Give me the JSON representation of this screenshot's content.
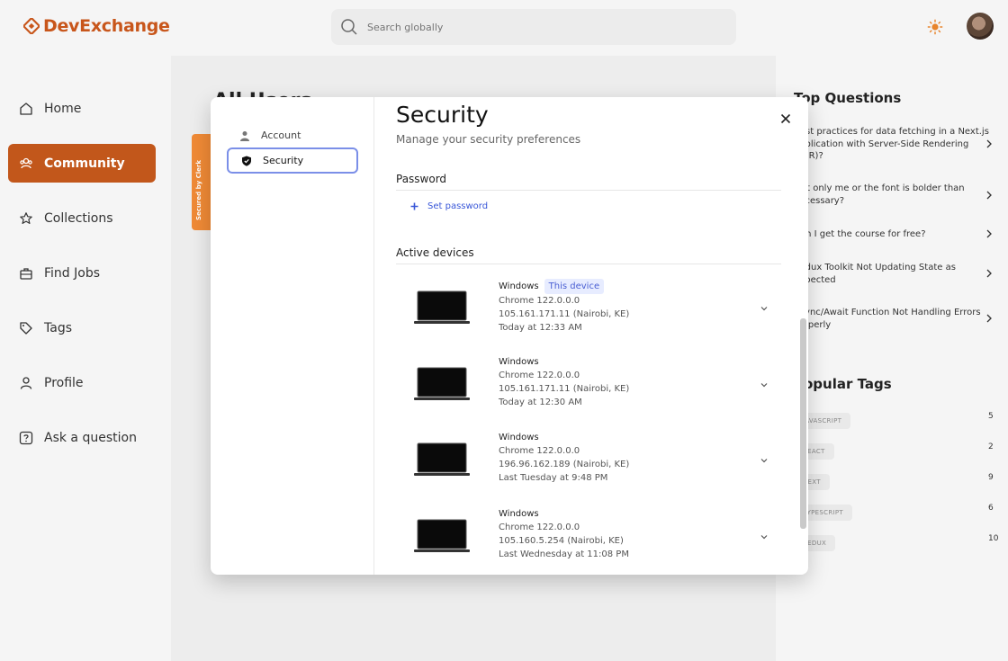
{
  "app": {
    "brand_prefix": "Dev",
    "brand_suffix": "Exchange",
    "search_placeholder": "Search globally"
  },
  "sidebar": {
    "items": [
      {
        "label": "Home",
        "icon": "home-icon"
      },
      {
        "label": "Community",
        "icon": "users-icon",
        "active": true
      },
      {
        "label": "Collections",
        "icon": "star-icon"
      },
      {
        "label": "Find Jobs",
        "icon": "briefcase-icon"
      },
      {
        "label": "Tags",
        "icon": "tag-icon"
      },
      {
        "label": "Profile",
        "icon": "user-icon"
      },
      {
        "label": "Ask a question",
        "icon": "question-icon"
      }
    ]
  },
  "main": {
    "title": "All Users"
  },
  "rightbar": {
    "top_questions_heading": "Top Questions",
    "questions": [
      "Best practices for data fetching in a Next.js application with Server-Side Rendering (SSR)?",
      "Is it only me or the font is bolder than necessary?",
      "Can I get the course for free?",
      "Redux Toolkit Not Updating State as Expected",
      "Async/Await Function Not Handling Errors Properly"
    ],
    "popular_tags_heading": "Popular Tags",
    "tags": [
      {
        "name": "JAVASCRIPT",
        "count": "5"
      },
      {
        "name": "REACT",
        "count": "2"
      },
      {
        "name": "NEXT",
        "count": "9"
      },
      {
        "name": "TYPESCRIPT",
        "count": "6"
      },
      {
        "name": "REDUX",
        "count": "10"
      }
    ]
  },
  "clerk_badge": "Secured by Clerk",
  "modal": {
    "nav": [
      {
        "label": "Account",
        "icon": "user-icon"
      },
      {
        "label": "Security",
        "icon": "shield-icon",
        "active": true
      }
    ],
    "title": "Security",
    "subtitle": "Manage your security preferences",
    "password_heading": "Password",
    "set_password_label": "Set password",
    "devices_heading": "Active devices",
    "this_device_badge": "This device",
    "devices": [
      {
        "os": "Windows",
        "browser": "Chrome 122.0.0.0",
        "ip": "105.161.171.11 (Nairobi, KE)",
        "time": "Today at 12:33 AM",
        "current": true
      },
      {
        "os": "Windows",
        "browser": "Chrome 122.0.0.0",
        "ip": "105.161.171.11 (Nairobi, KE)",
        "time": "Today at 12:30 AM",
        "current": false
      },
      {
        "os": "Windows",
        "browser": "Chrome 122.0.0.0",
        "ip": "196.96.162.189 (Nairobi, KE)",
        "time": "Last Tuesday at 9:48 PM",
        "current": false
      },
      {
        "os": "Windows",
        "browser": "Chrome 122.0.0.0",
        "ip": "105.160.5.254 (Nairobi, KE)",
        "time": "Last Wednesday at 11:08 PM",
        "current": false
      }
    ]
  },
  "colors": {
    "brand": "#c2571b",
    "link": "#3957d8",
    "focus_ring": "#7b8fe8",
    "clerk_orange": "#f08a36"
  }
}
